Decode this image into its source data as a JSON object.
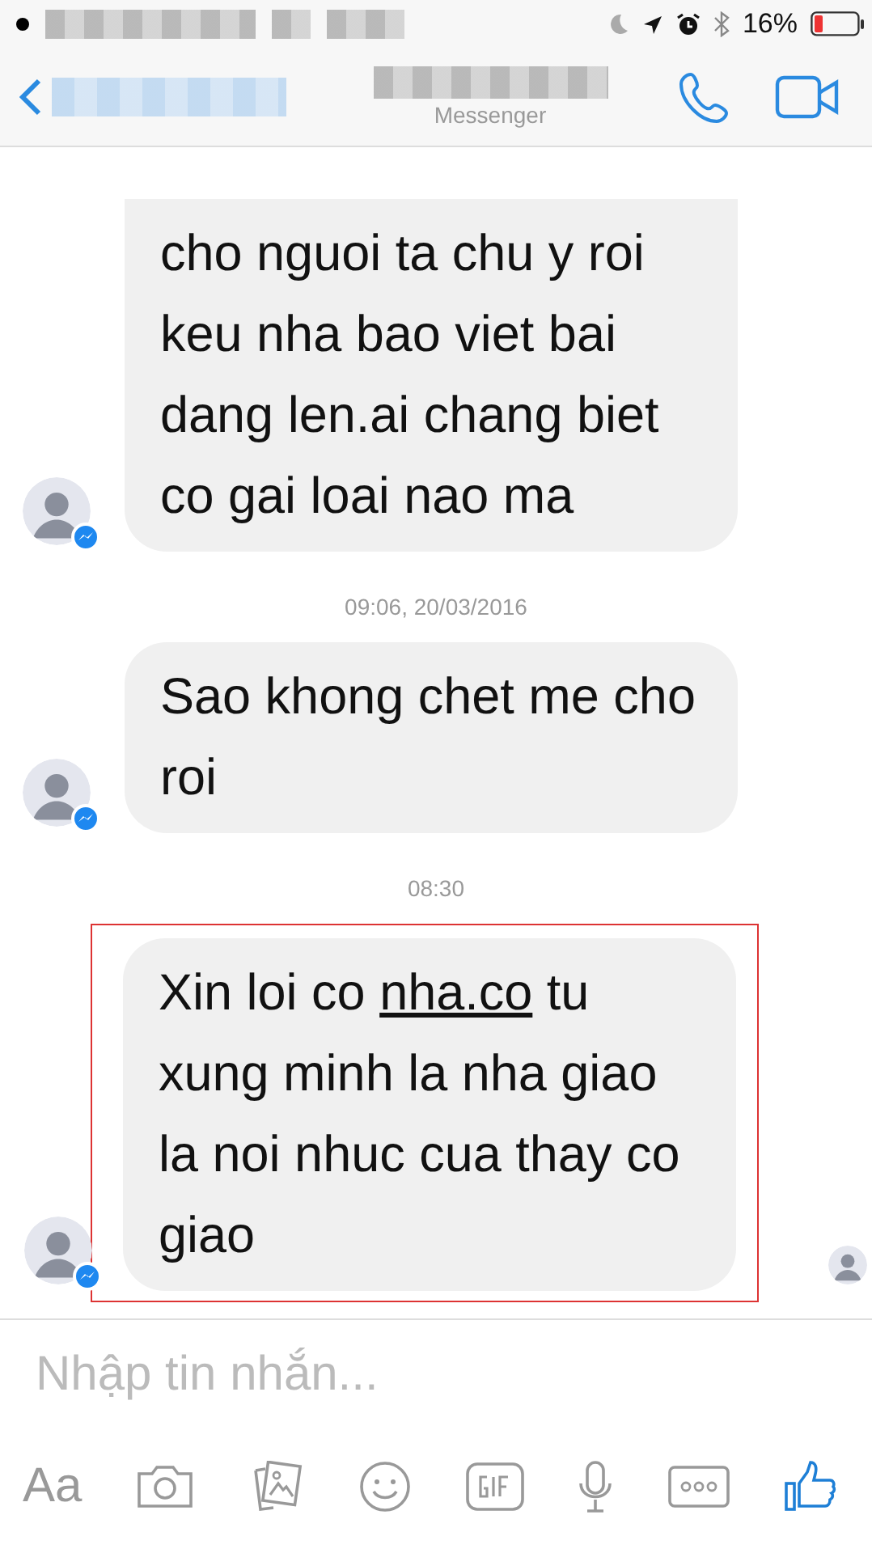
{
  "status_bar": {
    "battery": "16%"
  },
  "header": {
    "subtitle": "Messenger"
  },
  "messages": [
    {
      "kind": "message",
      "continued": true,
      "parts": [
        {
          "text": "cho nguoi ta chu y roi keu nha bao viet bai dang len.ai chang biet co gai loai nao ma"
        }
      ]
    },
    {
      "kind": "timestamp",
      "text": "09:06, 20/03/2016"
    },
    {
      "kind": "message",
      "continued": false,
      "parts": [
        {
          "text": "Sao khong chet me cho roi"
        }
      ]
    },
    {
      "kind": "timestamp",
      "text": "08:30"
    },
    {
      "kind": "message",
      "continued": false,
      "highlighted": true,
      "seen": true,
      "parts": [
        {
          "text": "Xin loi co "
        },
        {
          "text": "nha.co",
          "kind": "link"
        },
        {
          "text": " tu xung minh la nha giao la noi nhuc cua thay co giao"
        }
      ]
    }
  ],
  "composer": {
    "placeholder": "Nhập tin nhắn...",
    "toolbar_label": "Aa"
  }
}
